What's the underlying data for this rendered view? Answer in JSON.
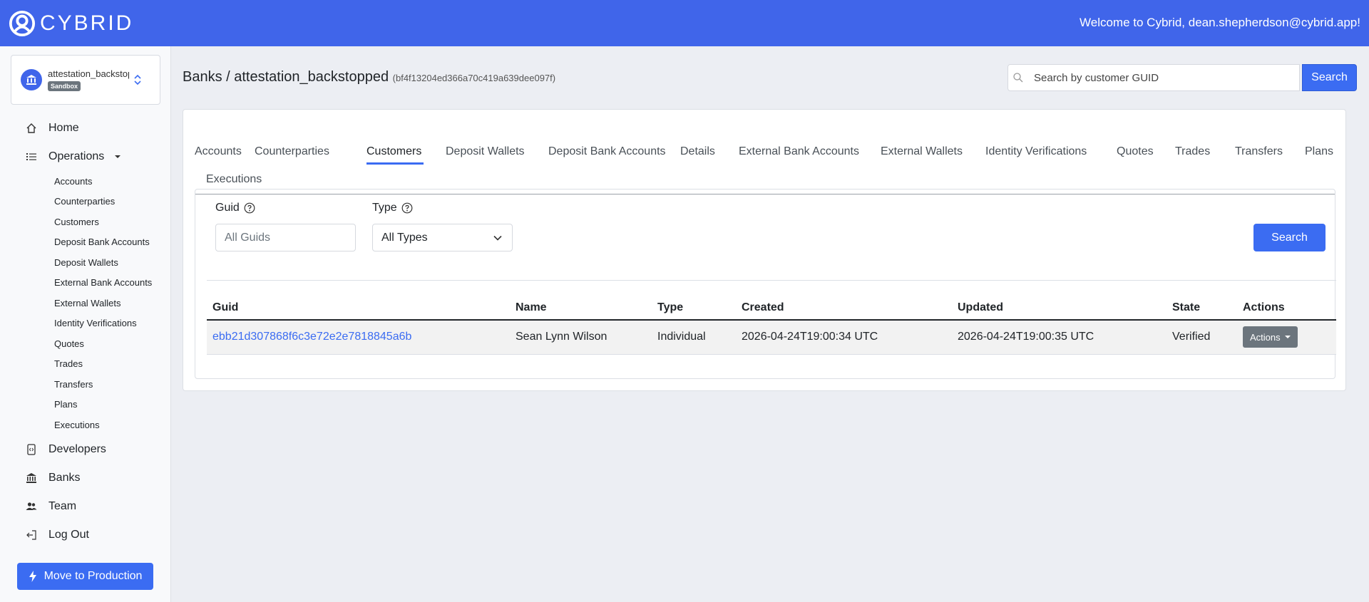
{
  "app": {
    "logo_text": "CYBRID",
    "welcome": "Welcome to Cybrid, dean.shepherdson@cybrid.app!"
  },
  "bank_switcher": {
    "name": "attestation_backstopped",
    "badge": "Sandbox"
  },
  "sidebar": {
    "home": "Home",
    "operations": "Operations",
    "operations_items": [
      "Accounts",
      "Counterparties",
      "Customers",
      "Deposit Bank Accounts",
      "Deposit Wallets",
      "External Bank Accounts",
      "External Wallets",
      "Identity Verifications",
      "Quotes",
      "Trades",
      "Transfers",
      "Plans",
      "Executions"
    ],
    "developers": "Developers",
    "banks": "Banks",
    "team": "Team",
    "logout": "Log Out",
    "move_to_production": "Move to Production"
  },
  "header": {
    "breadcrumb": "Banks / attestation_backstopped",
    "bank_guid": "(bf4f13204ed366a70c419a639dee097f)",
    "search_placeholder": "Search by customer GUID",
    "search_button": "Search"
  },
  "tabs": [
    "Accounts",
    "Counterparties",
    "Customers",
    "Deposit Wallets",
    "Deposit Bank Accounts",
    "Details",
    "External Bank Accounts",
    "External Wallets",
    "Identity Verifications",
    "Quotes",
    "Trades",
    "Transfers",
    "Plans",
    "Executions"
  ],
  "active_tab": "Customers",
  "filters": {
    "guid_label": "Guid",
    "guid_placeholder": "All Guids",
    "type_label": "Type",
    "type_value": "All Types",
    "search_button": "Search"
  },
  "table": {
    "headers": [
      "Guid",
      "Name",
      "Type",
      "Created",
      "Updated",
      "State",
      "Actions"
    ],
    "rows": [
      {
        "guid": "ebb21d307868f6c3e72e2e7818845a6b",
        "name": "Sean Lynn Wilson",
        "type": "Individual",
        "created": "2026-04-24T19:00:34 UTC",
        "updated": "2026-04-24T19:00:35 UTC",
        "state": "Verified",
        "action": "Actions"
      }
    ]
  },
  "colors": {
    "brand": "#4065ea",
    "primary_button": "#3b6cf2",
    "secondary_button": "#6c757d"
  }
}
